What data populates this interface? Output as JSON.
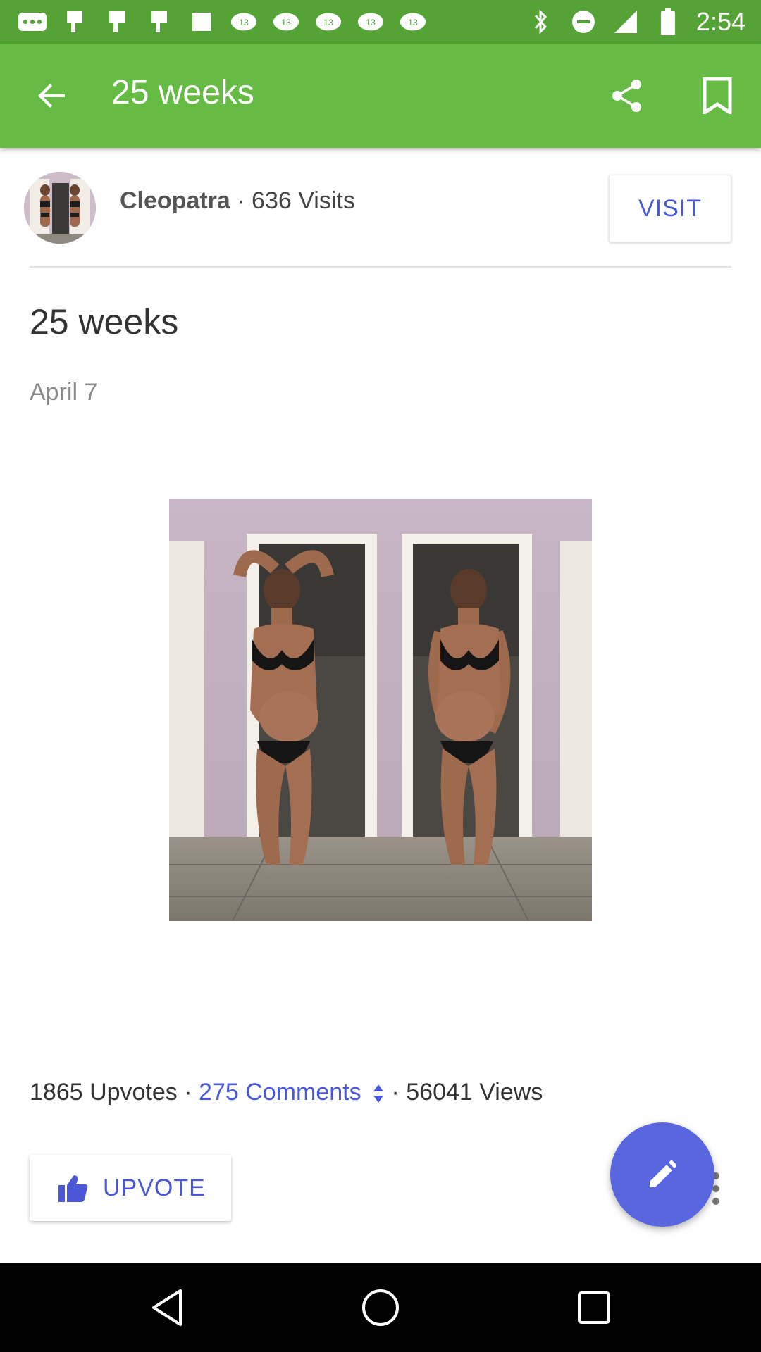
{
  "status_bar": {
    "time": "2:54",
    "left_icons": [
      "more-dots-icon",
      "flag-icon",
      "flag-icon",
      "flag-icon",
      "square-icon",
      "abc13-icon",
      "abc13-icon",
      "abc13-icon",
      "abc13-icon",
      "abc13-icon"
    ],
    "right_icons": [
      "bluetooth-icon",
      "dnd-icon",
      "signal-icon",
      "battery-icon"
    ]
  },
  "app_bar": {
    "title": "25 weeks",
    "back_icon": "arrow-back-icon",
    "share_icon": "share-icon",
    "bookmark_icon": "bookmark-icon",
    "color": "#66bb44"
  },
  "author": {
    "name": "Cleopatra",
    "separator": " · ",
    "visits": "636 Visits",
    "visit_button": "VISIT"
  },
  "post": {
    "title": "25 weeks",
    "date": "April 7"
  },
  "stats": {
    "upvotes": "1865 Upvotes",
    "sep1": " · ",
    "comments": "275 Comments",
    "sep2": " · ",
    "views": "56041 Views"
  },
  "actions": {
    "upvote_label": "UPVOTE",
    "fab_icon": "pencil-icon"
  },
  "nav": {
    "back": "nav-back-icon",
    "home": "nav-home-icon",
    "recents": "nav-recents-icon"
  },
  "colors": {
    "accent": "#4a57d6",
    "fab": "#5866e0",
    "status_bar": "#55a336"
  }
}
